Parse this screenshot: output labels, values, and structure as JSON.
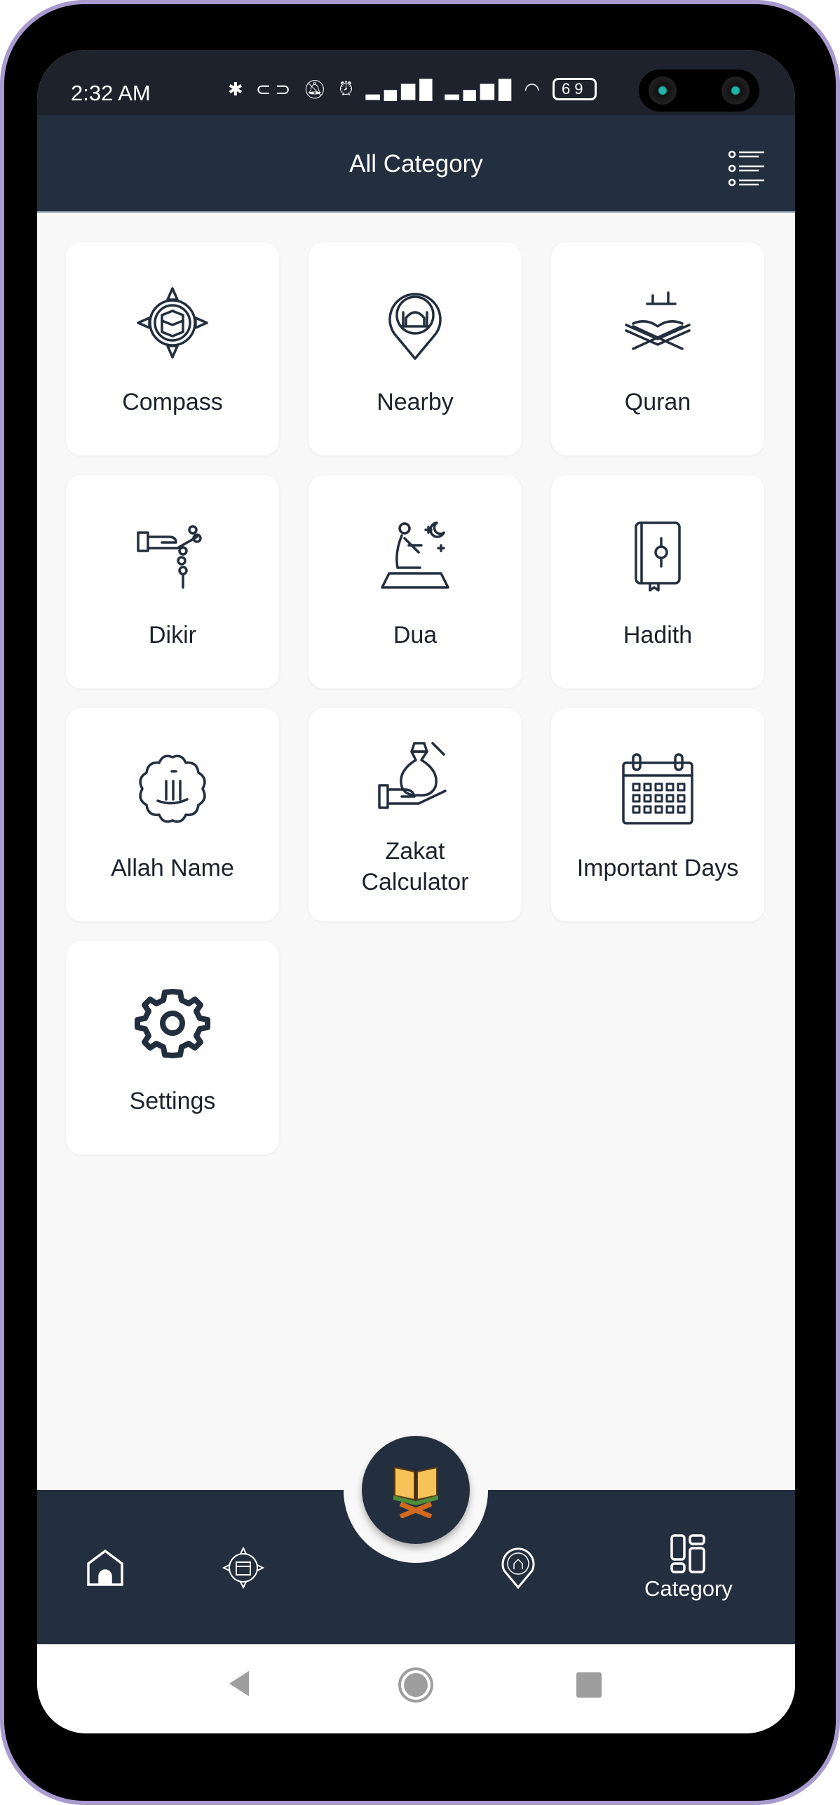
{
  "status_bar": {
    "time": "2:32 AM",
    "battery": "69",
    "icons": [
      "bluetooth-icon",
      "toggle-icon",
      "vibrate-off-icon",
      "alarm-icon",
      "volte-icon",
      "signal-icon",
      "volte-icon",
      "signal-icon",
      "wifi-icon",
      "battery-icon"
    ]
  },
  "app_bar": {
    "title": "All Category",
    "menu_icon": "list-menu-icon"
  },
  "categories": [
    {
      "label": "Compass",
      "icon": "kaaba-compass-icon"
    },
    {
      "label": "Nearby",
      "icon": "mosque-pin-icon"
    },
    {
      "label": "Quran",
      "icon": "quran-stand-icon"
    },
    {
      "label": "Dikir",
      "icon": "prayer-beads-hand-icon"
    },
    {
      "label": "Dua",
      "icon": "praying-man-icon"
    },
    {
      "label": "Hadith",
      "icon": "hadith-book-icon"
    },
    {
      "label": "Allah Name",
      "icon": "allah-calligraphy-icon"
    },
    {
      "label": "Zakat Calculator",
      "icon": "money-bag-hand-icon"
    },
    {
      "label": "Important Days",
      "icon": "calendar-icon"
    },
    {
      "label": "Settings",
      "icon": "gear-icon"
    }
  ],
  "bottom_nav": {
    "items": [
      {
        "icon": "home-icon",
        "label": ""
      },
      {
        "icon": "kaaba-compass-icon",
        "label": ""
      },
      {
        "icon": "quran-icon",
        "label": ""
      },
      {
        "icon": "mosque-pin-icon",
        "label": ""
      },
      {
        "icon": "category-icon",
        "label": "Category",
        "active": true
      }
    ]
  },
  "colors": {
    "primary": "#232e3e",
    "background": "#f8f8f8",
    "card": "#ffffff",
    "frame": "#a99ad0"
  }
}
